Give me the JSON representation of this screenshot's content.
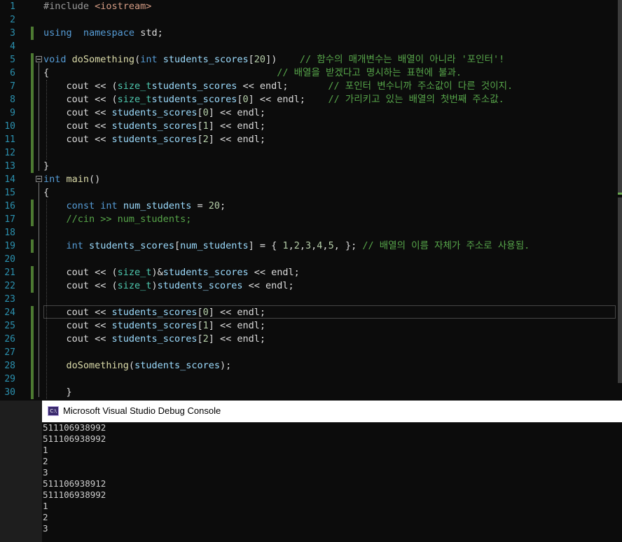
{
  "editor": {
    "lines": [
      {
        "num": "1",
        "tokens": [
          [
            "p",
            "#include "
          ],
          [
            "s",
            "<iostream>"
          ]
        ]
      },
      {
        "num": "2",
        "tokens": []
      },
      {
        "num": "3",
        "tokens": [
          [
            "k",
            "using"
          ],
          [
            "",
            "  "
          ],
          [
            "k",
            "namespace"
          ],
          [
            "",
            " std;"
          ]
        ]
      },
      {
        "num": "4",
        "tokens": []
      },
      {
        "num": "5",
        "tokens": [
          [
            "k",
            "void"
          ],
          [
            "",
            " "
          ],
          [
            "f",
            "doSomething"
          ],
          [
            "",
            "("
          ],
          [
            "k",
            "int"
          ],
          [
            "",
            " "
          ],
          [
            "v",
            "students_scores"
          ],
          [
            "",
            "["
          ],
          [
            "n",
            "20"
          ],
          [
            "",
            "])    "
          ],
          [
            "c",
            "// 함수의 매개변수는 배열이 아니라 '포인터'!"
          ]
        ]
      },
      {
        "num": "6",
        "tokens": [
          [
            "",
            "{                                        "
          ],
          [
            "c",
            "// 배열을 받겠다고 명시하는 표현에 불과."
          ]
        ]
      },
      {
        "num": "7",
        "tokens": [
          [
            "",
            "    cout << ("
          ],
          [
            "t",
            "size_t"
          ],
          [
            ")&"
          ],
          [
            "v",
            "students_scores"
          ],
          [
            "",
            " << endl;       "
          ],
          [
            "c",
            "// 포인터 변수니까 주소값이 다른 것이지."
          ]
        ]
      },
      {
        "num": "8",
        "tokens": [
          [
            "",
            "    cout << ("
          ],
          [
            "t",
            "size_t"
          ],
          [
            ")&"
          ],
          [
            "v",
            "students_scores"
          ],
          [
            "",
            "["
          ],
          [
            "n",
            "0"
          ],
          [
            "",
            "] << endl;    "
          ],
          [
            "c",
            "// 가리키고 있는 배열의 첫번째 주소값."
          ]
        ]
      },
      {
        "num": "9",
        "tokens": [
          [
            "",
            "    cout << "
          ],
          [
            "v",
            "students_scores"
          ],
          [
            "",
            "["
          ],
          [
            "n",
            "0"
          ],
          [
            "",
            "] << endl;"
          ]
        ]
      },
      {
        "num": "10",
        "tokens": [
          [
            "",
            "    cout << "
          ],
          [
            "v",
            "students_scores"
          ],
          [
            "",
            "["
          ],
          [
            "n",
            "1"
          ],
          [
            "",
            "] << endl;"
          ]
        ]
      },
      {
        "num": "11",
        "tokens": [
          [
            "",
            "    cout << "
          ],
          [
            "v",
            "students_scores"
          ],
          [
            "",
            "["
          ],
          [
            "n",
            "2"
          ],
          [
            "",
            "] << endl;"
          ]
        ]
      },
      {
        "num": "12",
        "tokens": []
      },
      {
        "num": "13",
        "tokens": [
          [
            "",
            "}"
          ]
        ]
      },
      {
        "num": "14",
        "tokens": [
          [
            "k",
            "int"
          ],
          [
            "",
            " "
          ],
          [
            "f",
            "main"
          ],
          [
            "",
            "()"
          ]
        ]
      },
      {
        "num": "15",
        "tokens": [
          [
            "",
            "{"
          ]
        ]
      },
      {
        "num": "16",
        "tokens": [
          [
            "",
            "    "
          ],
          [
            "k",
            "const"
          ],
          [
            "",
            " "
          ],
          [
            "k",
            "int"
          ],
          [
            "",
            " "
          ],
          [
            "v",
            "num_students"
          ],
          [
            "",
            " = "
          ],
          [
            "n",
            "20"
          ],
          [
            "",
            ";"
          ]
        ]
      },
      {
        "num": "17",
        "tokens": [
          [
            "",
            "    "
          ],
          [
            "c",
            "//cin >> num_students;"
          ]
        ]
      },
      {
        "num": "18",
        "tokens": []
      },
      {
        "num": "19",
        "tokens": [
          [
            "",
            "    "
          ],
          [
            "k",
            "int"
          ],
          [
            "",
            " "
          ],
          [
            "v",
            "students_scores"
          ],
          [
            "",
            "["
          ],
          [
            "v",
            "num_students"
          ],
          [
            "",
            "] = { "
          ],
          [
            "n",
            "1"
          ],
          [
            "",
            ","
          ],
          [
            "n",
            "2"
          ],
          [
            "",
            ","
          ],
          [
            "n",
            "3"
          ],
          [
            "",
            ","
          ],
          [
            "n",
            "4"
          ],
          [
            "",
            ","
          ],
          [
            "n",
            "5"
          ],
          [
            "",
            ", }; "
          ],
          [
            "c",
            "// 배열의 이름 자체가 주소로 사용됨."
          ]
        ]
      },
      {
        "num": "20",
        "tokens": []
      },
      {
        "num": "21",
        "tokens": [
          [
            "",
            "    cout << ("
          ],
          [
            "t",
            "size_t"
          ],
          [
            "",
            ")&"
          ],
          [
            "v",
            "students_scores"
          ],
          [
            "",
            " << endl;"
          ]
        ]
      },
      {
        "num": "22",
        "tokens": [
          [
            "",
            "    cout << ("
          ],
          [
            "t",
            "size_t"
          ],
          [
            "",
            ")"
          ],
          [
            "v",
            "students_scores"
          ],
          [
            "",
            " << endl;"
          ]
        ]
      },
      {
        "num": "23",
        "tokens": []
      },
      {
        "num": "24",
        "tokens": [
          [
            "",
            "    cout << "
          ],
          [
            "v",
            "students_scores"
          ],
          [
            "",
            "["
          ],
          [
            "n",
            "0"
          ],
          [
            "",
            "] << endl;"
          ]
        ]
      },
      {
        "num": "25",
        "tokens": [
          [
            "",
            "    cout << "
          ],
          [
            "v",
            "students_scores"
          ],
          [
            "",
            "["
          ],
          [
            "n",
            "1"
          ],
          [
            "",
            "] << endl;"
          ]
        ]
      },
      {
        "num": "26",
        "tokens": [
          [
            "",
            "    cout << "
          ],
          [
            "v",
            "students_scores"
          ],
          [
            "",
            "["
          ],
          [
            "n",
            "2"
          ],
          [
            "",
            "] << endl;"
          ]
        ]
      },
      {
        "num": "27",
        "tokens": []
      },
      {
        "num": "28",
        "tokens": [
          [
            "",
            "    "
          ],
          [
            "f",
            "doSomething"
          ],
          [
            "",
            "("
          ],
          [
            "v",
            "students_scores"
          ],
          [
            "",
            ");"
          ]
        ]
      },
      {
        "num": "29",
        "tokens": []
      },
      {
        "num": "30",
        "tokens": [
          [
            "",
            "    }"
          ]
        ]
      }
    ]
  },
  "console": {
    "icon_text": "C:\\",
    "title": "Microsoft Visual Studio Debug Console",
    "output": [
      "511106938992",
      "511106938992",
      "1",
      "2",
      "3",
      "511106938912",
      "511106938992",
      "1",
      "2",
      "3"
    ]
  },
  "colors": {
    "background": "#0c0c0c",
    "line_number": "#2b91af",
    "keyword": "#569cd6",
    "type": "#4ec9b0",
    "function": "#dcdcaa",
    "variable": "#9cdcfe",
    "number": "#b5cea8",
    "comment": "#57a64a",
    "changed_bar": "#4d7a32"
  }
}
